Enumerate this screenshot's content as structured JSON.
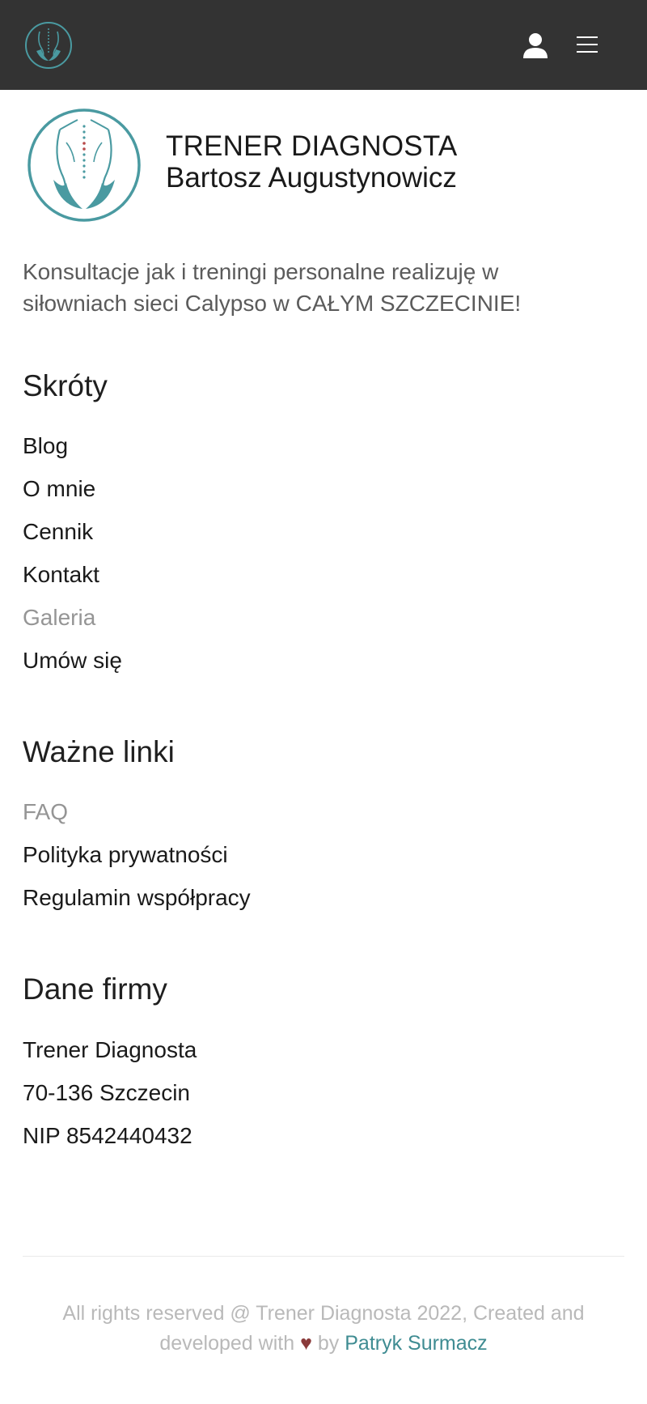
{
  "header": {
    "logo_icon": "diagnosta-logo-icon",
    "user_icon": "user-icon",
    "menu_icon": "hamburger-menu-icon"
  },
  "brand": {
    "title_line1": "TRENER DIAGNOSTA",
    "title_line2": "Bartosz Augustynowicz"
  },
  "intro": {
    "text": "Konsultacje jak i treningi personalne realizuję w siłowniach sieci Calypso w CAŁYM SZCZECINIE!"
  },
  "shortcuts": {
    "title": "Skróty",
    "items": [
      "Blog",
      "O mnie",
      "Cennik",
      "Kontakt",
      "Galeria",
      "Umów się"
    ]
  },
  "important_links": {
    "title": "Ważne linki",
    "items": [
      "FAQ",
      "Polityka prywatności",
      "Regulamin współpracy"
    ]
  },
  "company": {
    "title": "Dane firmy",
    "items": [
      "Trener Diagnosta",
      "70-136 Szczecin",
      "NIP 8542440432"
    ]
  },
  "footer": {
    "text_before": "All rights reserved @ Trener Diagnosta 2022, Created and developed with",
    "heart": "♥",
    "text_by": "by",
    "author": "Patryk Surmacz"
  },
  "colors": {
    "topbar": "#333333",
    "accent_teal": "#4a9aa1",
    "muted_link": "#959595",
    "heart": "#8a3a3a"
  }
}
